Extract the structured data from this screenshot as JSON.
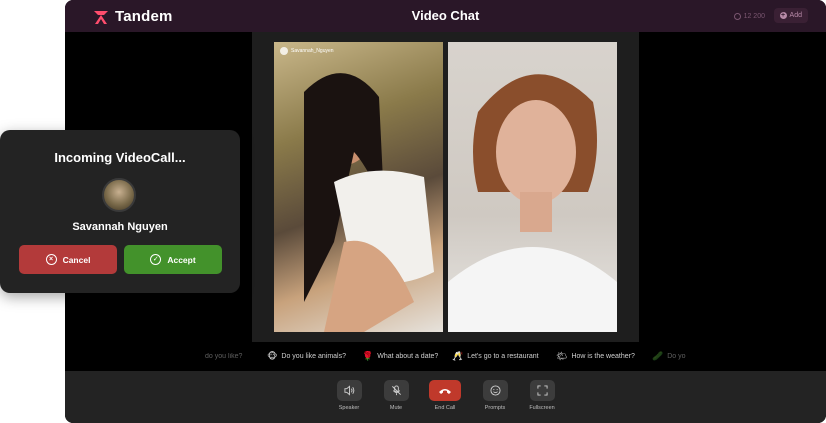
{
  "app": {
    "brand": "Tandem",
    "title": "Video Chat",
    "credits": "12 200",
    "add_label": "Add"
  },
  "videos": {
    "left_username": "Savannah_Nguyen"
  },
  "prompts": [
    {
      "emoji": "",
      "text": "do you like?"
    },
    {
      "emoji": "🐵",
      "text": "Do you like animals?"
    },
    {
      "emoji": "🌹",
      "text": "What about a date?"
    },
    {
      "emoji": "🥂",
      "text": "Let's go to a restaurant"
    },
    {
      "emoji": "🌤",
      "text": "How is the weather?"
    },
    {
      "emoji": "🥒",
      "text": "Do yo"
    }
  ],
  "controls": [
    {
      "label": "Speaker",
      "icon": "speaker-icon"
    },
    {
      "label": "Mute",
      "icon": "mic-mute-icon"
    },
    {
      "label": "End Call",
      "icon": "phone-hangup-icon"
    },
    {
      "label": "Prompts",
      "icon": "smile-icon"
    },
    {
      "label": "Fullscreen",
      "icon": "fullscreen-icon"
    }
  ],
  "incoming": {
    "title": "Incoming VideoCall...",
    "caller": "Savannah Nguyen",
    "cancel_label": "Cancel",
    "accept_label": "Accept"
  },
  "colors": {
    "topbar": "#2a1728",
    "cancel": "#b33a3a",
    "accept": "#43922b",
    "end_call": "#c0392b",
    "brand": "#ff4d6d"
  }
}
